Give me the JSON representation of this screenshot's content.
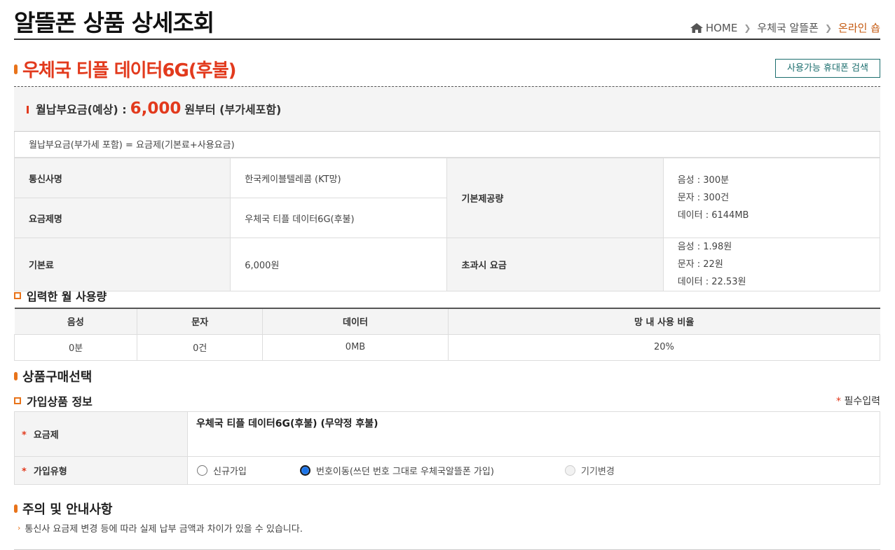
{
  "header": {
    "title": "알뜰폰 상품 상세조회",
    "breadcrumb": [
      "HOME",
      "우체국 알뜰폰",
      "온라인 숍"
    ]
  },
  "plan": {
    "title": "우체국 티플 데이터6G(후불)",
    "phone_search_label": "사용가능 휴대폰 검색"
  },
  "fee": {
    "prefix": "월납부요금(예상) :",
    "amount": "6,000",
    "suffix": "원부터 (부가세포함)",
    "formula": "월납부요금(부가세 포함) = 요금제(기본료+사용요금)"
  },
  "info": {
    "carrier_label": "통신사명",
    "carrier_value": "한국케이블텔레콤 (KT망)",
    "plan_label": "요금제명",
    "plan_value": "우체국 티플 데이터6G(후불)",
    "base_fee_label": "기본료",
    "base_fee_value": "6,000원",
    "provided_label": "기본제공량",
    "provided": [
      "음성 : 300분",
      "문자 : 300건",
      "데이터 : 6144MB"
    ],
    "overage_label": "초과시 요금",
    "overage": [
      "음성 : 1.98원",
      "문자 : 22원",
      "데이터 : 22.53원"
    ]
  },
  "usage": {
    "heading": "입력한 월 사용량",
    "columns": [
      "음성",
      "문자",
      "데이터",
      "망 내 사용 비율"
    ],
    "values": [
      "0분",
      "0건",
      "0MB",
      "20%"
    ]
  },
  "purchase": {
    "heading": "상품구매선택",
    "sub_heading": "가입상품 정보",
    "required_note": "필수입력",
    "required_mark": "*",
    "plan_label": "요금제",
    "plan_value": "우체국 티플 데이터6G(후불) (무약정 후불)",
    "join_type_label": "가입유형",
    "join_options": [
      "신규가입",
      "번호이동(쓰던 번호 그대로 우체국알뜰폰 가입)",
      "기기변경"
    ],
    "selected_option": "번호이동(쓰던 번호 그대로 우체국알뜰폰 가입)"
  },
  "notice": {
    "heading": "주의 및 안내사항",
    "items": [
      "통신사 요금제 변경 등에 따라 실제 납부 금액과 차이가 있을 수 있습니다."
    ]
  },
  "colors": {
    "accent_red": "#e23a1d",
    "accent_orange": "#e8731a",
    "teal": "#1c6e6e"
  }
}
